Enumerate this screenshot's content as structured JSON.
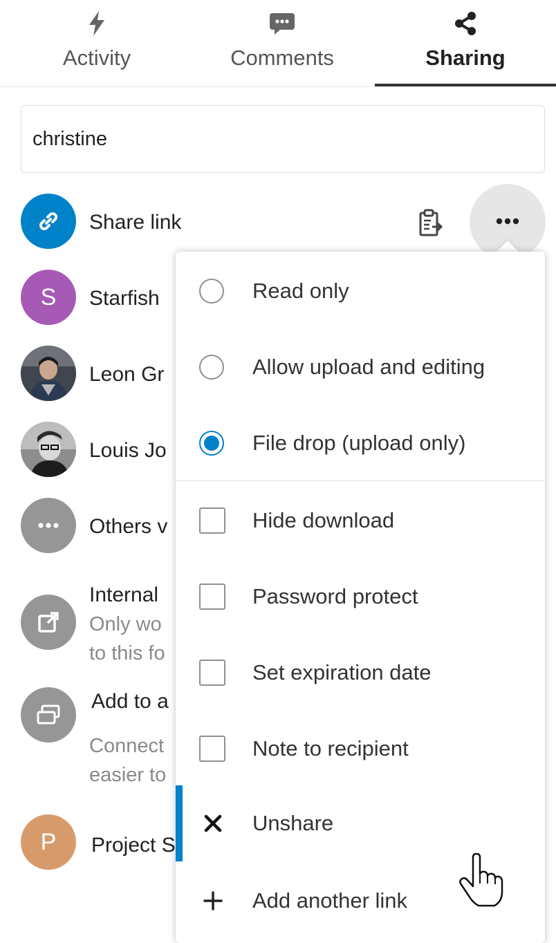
{
  "tabs": [
    {
      "label": "Activity",
      "icon": "activity-bolt-icon",
      "active": false
    },
    {
      "label": "Comments",
      "icon": "comment-icon",
      "active": false
    },
    {
      "label": "Sharing",
      "icon": "share-icon",
      "active": true
    }
  ],
  "search": {
    "value": "christine"
  },
  "shares": [
    {
      "label": "Share link",
      "avatar_icon": "link-icon",
      "color": "#0082c9"
    },
    {
      "label": "Starfish",
      "avatar_letter": "S",
      "color": "#a65ab5"
    },
    {
      "label": "Leon Gr",
      "avatar_type": "photo"
    },
    {
      "label": "Louis Jo",
      "avatar_type": "photo"
    },
    {
      "label": "Others v",
      "avatar_icon": "more-icon",
      "color": "#969696"
    },
    {
      "label": "Internal",
      "sub1": "Only wo",
      "sub2": "to this fo",
      "avatar_icon": "external-link-icon",
      "color": "#969696"
    },
    {
      "label": "Add to a",
      "sub1": "Connect",
      "sub2": "easier to",
      "avatar_icon": "projects-icon",
      "color": "#969696"
    },
    {
      "label": "Project S",
      "avatar_letter": "P",
      "color": "#d79b6b"
    }
  ],
  "menu": {
    "radio_options": [
      {
        "label": "Read only",
        "checked": false
      },
      {
        "label": "Allow upload and editing",
        "checked": false
      },
      {
        "label": "File drop (upload only)",
        "checked": true
      }
    ],
    "checkbox_options": [
      {
        "label": "Hide download",
        "checked": false
      },
      {
        "label": "Password protect",
        "checked": false
      },
      {
        "label": "Set expiration date",
        "checked": false
      },
      {
        "label": "Note to recipient",
        "checked": false
      }
    ],
    "unshare_label": "Unshare",
    "add_link_label": "Add another link"
  },
  "colors": {
    "accent": "#0082c9",
    "gray_avatar": "#969696"
  }
}
